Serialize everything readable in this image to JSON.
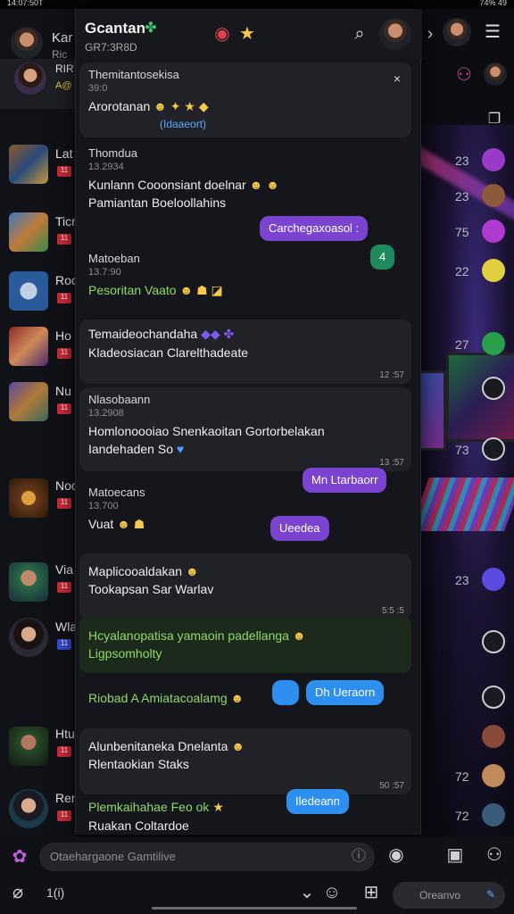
{
  "status": {
    "left": "14:07:50T",
    "right": "74% 49"
  },
  "sidebar": {
    "header": {
      "name": "Kar",
      "sub": "Ric"
    },
    "items": [
      {
        "name": "RIR",
        "sub": "A@"
      },
      {
        "name": "Lat",
        "sub": ""
      },
      {
        "name": "Ticr",
        "sub": ""
      },
      {
        "name": "Roc",
        "sub": ""
      },
      {
        "name": "Ho",
        "sub": ""
      },
      {
        "name": "Nu",
        "sub": ""
      },
      {
        "name": "Noc",
        "sub": ""
      },
      {
        "name": "Via",
        "sub": ""
      },
      {
        "name": "Wla",
        "sub": ""
      },
      {
        "name": "Htu",
        "sub": ""
      },
      {
        "name": "Ren",
        "sub": ""
      }
    ]
  },
  "rightcol": {
    "times": [
      "23",
      "23",
      "75",
      "22",
      "27",
      "73",
      "23",
      "72",
      "72"
    ]
  },
  "chat": {
    "title": "Gcantan",
    "subtitle": "GR7:3R8D",
    "messages": [
      {
        "sender": "Themitantosekisa",
        "meta": "39:0",
        "line1": "Arorotanan",
        "line2": "(Idaaeort)"
      },
      {
        "sender": "Thomdua",
        "meta": "13.2934",
        "line1": "Kunlann   Cooonsiant doelnar",
        "line2": "Pamiantan   Boeloollahins"
      },
      {
        "sender": "Matoeban",
        "meta": "13.7:90",
        "line1": "Pesoritan   Vaato",
        "line2": ""
      },
      {
        "sender": "",
        "meta": "",
        "line1": "Temaideochandaha",
        "line2": "Kladeosiacan   Clarelthadeate",
        "stamp": "12 :57"
      },
      {
        "sender": "Nlasobaann",
        "meta": "13.2908",
        "line1": "Homlonoooiao  Snenkaoitan  Gortorbelakan",
        "line2": "Iandehaden   So",
        "stamp": "13 :57"
      },
      {
        "sender": "Matoecans",
        "meta": "13.700",
        "line1": "Vuat",
        "line2": ""
      },
      {
        "sender": "",
        "meta": "",
        "line1": "Maplicooaldakan",
        "line2": "Tookapsan   Sar Warlav",
        "stamp": "5:5 :5"
      },
      {
        "sender": "",
        "meta": "",
        "line1": "Hcyalanopatisa yamaoin padellanga",
        "line2": "Ligpsomholty"
      },
      {
        "sender": "",
        "meta": "",
        "line1": "Riobad  A Amiatacoalamg",
        "line2": ""
      },
      {
        "sender": "",
        "meta": "",
        "line1": "Alunbenitaneka   Dnelanta",
        "line2": "Rlentaokian   Staks",
        "stamp": "50 :57"
      },
      {
        "sender": "",
        "meta": "",
        "line1": "Plemkaihahae Feo ok",
        "line2": "Ruakan   Coltardoe",
        "stamp": ""
      }
    ],
    "chips": [
      {
        "label": "Carchegaxoasol :"
      },
      {
        "label": "4"
      },
      {
        "label": "Mn Ltarbaorr"
      },
      {
        "label": "Ueedea"
      },
      {
        "label": "Dh Ueraorn"
      },
      {
        "label": "Iledeann"
      }
    ]
  },
  "composer": {
    "placeholder": "Otaehargaone Gamtilive",
    "tab_label": "Oreanvo",
    "counter": "1(i)"
  }
}
